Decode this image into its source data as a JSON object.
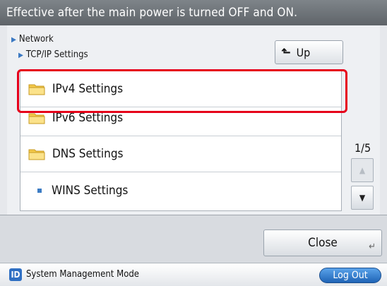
{
  "header": {
    "message": "Effective after the main power is turned OFF and ON."
  },
  "breadcrumb": {
    "level1": "Network",
    "level2": "TCP/IP Settings"
  },
  "up_button": {
    "label": "Up"
  },
  "list": {
    "items": [
      {
        "label": "IPv4 Settings",
        "icon": "folder-icon"
      },
      {
        "label": "IPv6 Settings",
        "icon": "folder-icon"
      },
      {
        "label": "DNS Settings",
        "icon": "folder-icon"
      },
      {
        "label": "WINS Settings",
        "icon": "bullet-icon"
      }
    ]
  },
  "pager": {
    "page": "1/5"
  },
  "close_button": {
    "label": "Close"
  },
  "status_bar": {
    "icon_label": "ID",
    "mode": "System Management Mode",
    "logout_label": "Log Out"
  },
  "colors": {
    "highlight": "#e6001a",
    "accent": "#2f6fc3"
  }
}
